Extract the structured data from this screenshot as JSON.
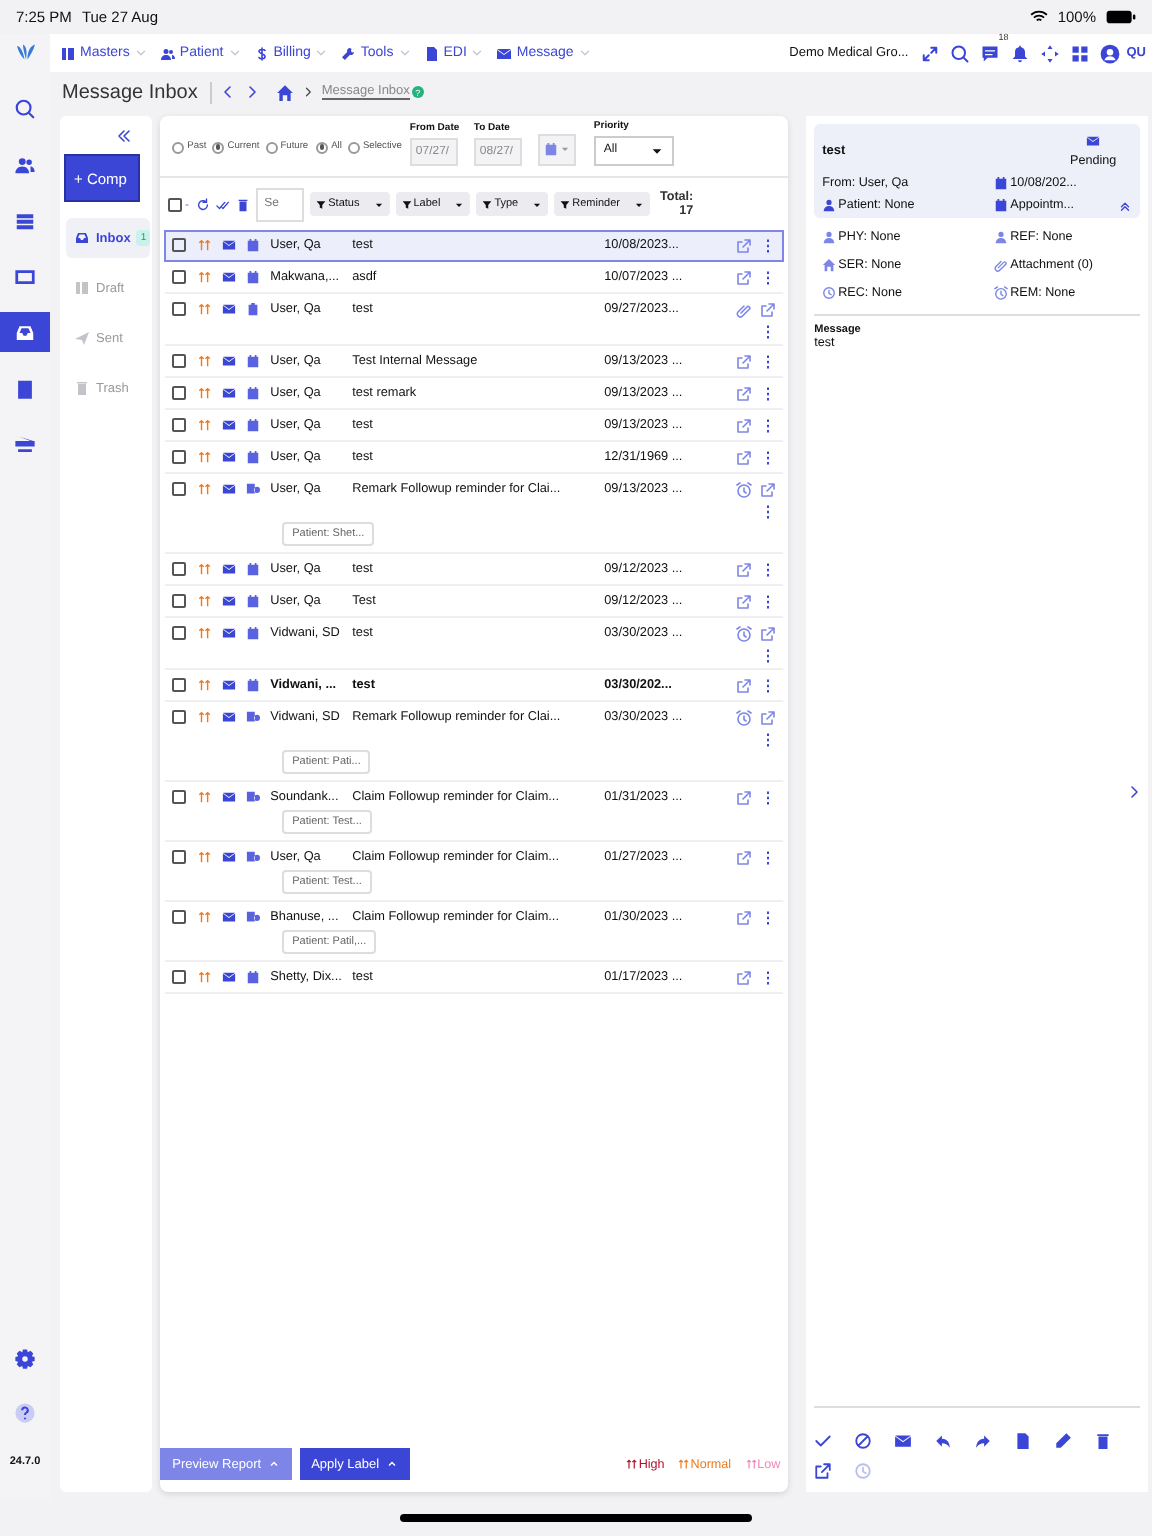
{
  "status_bar": {
    "time": "7:25 PM",
    "date": "Tue 27 Aug",
    "battery": "100%"
  },
  "nav": {
    "menus": [
      "Masters",
      "Patient",
      "Billing",
      "Tools",
      "EDI",
      "Message"
    ],
    "org": "Demo Medical Gro...",
    "notification_count": "18",
    "user_initials": "QU"
  },
  "rail": {
    "items": [
      {
        "selected": false
      },
      {
        "selected": false
      },
      {
        "selected": false
      },
      {
        "selected": false
      },
      {
        "selected": true
      },
      {
        "selected": false
      },
      {
        "selected": false
      }
    ],
    "version": "24.7.0"
  },
  "title": "Message Inbox",
  "breadcrumb": "Message Inbox",
  "help_badge": "?",
  "folders": {
    "compose": "+ Comp",
    "items": [
      {
        "label": "Inbox",
        "selected": true,
        "count": "1"
      },
      {
        "label": "Draft",
        "selected": false
      },
      {
        "label": "Sent",
        "selected": false
      },
      {
        "label": "Trash",
        "selected": false
      }
    ]
  },
  "filters": {
    "period": [
      {
        "label": "Past",
        "selected": false
      },
      {
        "label": "Current",
        "selected": true
      },
      {
        "label": "Future",
        "selected": false
      }
    ],
    "scope": [
      {
        "label": "All",
        "selected": true
      },
      {
        "label": "Selective",
        "selected": false
      }
    ],
    "from_date": {
      "label": "From Date",
      "value": "07/27/",
      "disabled": true
    },
    "to_date": {
      "label": "To Date",
      "value": "08/27/",
      "disabled": true
    },
    "priority": {
      "label": "Priority",
      "value": "All"
    }
  },
  "toolbar": {
    "select_all_checked": false,
    "search_placeholder": "Se",
    "dropdowns": [
      "Status",
      "Label",
      "Type",
      "Reminder"
    ],
    "total_label": "Total:",
    "total": "17"
  },
  "messages": [
    {
      "kind": "appointment",
      "checked": false,
      "selected": true,
      "unread": false,
      "has_attachment": false,
      "has_alarm": false,
      "sender": "User, Qa",
      "subject": "test",
      "date": "10/08/2023..."
    },
    {
      "kind": "appointment",
      "checked": false,
      "selected": false,
      "unread": false,
      "has_attachment": false,
      "has_alarm": false,
      "sender": "Makwana,...",
      "subject": "asdf",
      "date": "10/07/2023 ..."
    },
    {
      "kind": "task",
      "checked": false,
      "selected": false,
      "unread": false,
      "has_attachment": true,
      "has_alarm": false,
      "sender": "User, Qa",
      "subject": "test",
      "date": "09/27/2023..."
    },
    {
      "kind": "appointment",
      "checked": false,
      "selected": false,
      "unread": false,
      "has_attachment": false,
      "has_alarm": false,
      "sender": "User, Qa",
      "subject": "Test Internal Message",
      "date": "09/13/2023 ..."
    },
    {
      "kind": "appointment",
      "checked": false,
      "selected": false,
      "unread": false,
      "has_attachment": false,
      "has_alarm": false,
      "sender": "User, Qa",
      "subject": "test remark",
      "date": "09/13/2023 ..."
    },
    {
      "kind": "appointment",
      "checked": false,
      "selected": false,
      "unread": false,
      "has_attachment": false,
      "has_alarm": false,
      "sender": "User, Qa",
      "subject": "test",
      "date": "09/13/2023 ..."
    },
    {
      "kind": "appointment",
      "checked": false,
      "selected": false,
      "unread": false,
      "has_attachment": false,
      "has_alarm": false,
      "sender": "User, Qa",
      "subject": "test",
      "date": "12/31/1969 ..."
    },
    {
      "kind": "reminder",
      "checked": false,
      "selected": false,
      "unread": false,
      "has_attachment": false,
      "has_alarm": true,
      "sender": "User, Qa",
      "subject": "Remark Followup reminder for Clai...",
      "date": "09/13/2023 ...",
      "patient": "Patient: Shet..."
    },
    {
      "kind": "appointment",
      "checked": false,
      "selected": false,
      "unread": false,
      "has_attachment": false,
      "has_alarm": false,
      "sender": "User, Qa",
      "subject": "test",
      "date": "09/12/2023 ..."
    },
    {
      "kind": "appointment",
      "checked": false,
      "selected": false,
      "unread": false,
      "has_attachment": false,
      "has_alarm": false,
      "sender": "User, Qa",
      "subject": "Test",
      "date": "09/12/2023 ..."
    },
    {
      "kind": "appointment",
      "checked": false,
      "selected": false,
      "unread": false,
      "has_attachment": false,
      "has_alarm": true,
      "sender": "Vidwani, SD",
      "subject": "test",
      "date": "03/30/2023 ..."
    },
    {
      "kind": "appointment",
      "checked": false,
      "selected": false,
      "unread": true,
      "has_attachment": false,
      "has_alarm": false,
      "sender": "Vidwani, ...",
      "subject": "test",
      "date": "03/30/202..."
    },
    {
      "kind": "reminder",
      "checked": false,
      "selected": false,
      "unread": false,
      "has_attachment": false,
      "has_alarm": true,
      "sender": "Vidwani, SD",
      "subject": "Remark Followup reminder for Clai...",
      "date": "03/30/2023 ...",
      "patient": "Patient: Pati..."
    },
    {
      "kind": "reminder",
      "checked": false,
      "selected": false,
      "unread": false,
      "has_attachment": false,
      "has_alarm": false,
      "sender": "Soundank...",
      "subject": "Claim Followup reminder for Claim...",
      "date": "01/31/2023 ...",
      "patient": "Patient: Test..."
    },
    {
      "kind": "reminder",
      "checked": false,
      "selected": false,
      "unread": false,
      "has_attachment": false,
      "has_alarm": false,
      "sender": "User, Qa",
      "subject": "Claim Followup reminder for Claim...",
      "date": "01/27/2023 ...",
      "patient": "Patient: Test..."
    },
    {
      "kind": "reminder",
      "checked": false,
      "selected": false,
      "unread": false,
      "has_attachment": false,
      "has_alarm": false,
      "sender": "Bhanuse, ...",
      "subject": "Claim Followup reminder for Claim...",
      "date": "01/30/2023 ...",
      "patient": "Patient: Patil,..."
    },
    {
      "kind": "appointment",
      "checked": false,
      "selected": false,
      "unread": false,
      "has_attachment": false,
      "has_alarm": false,
      "sender": "Shetty, Dix...",
      "subject": "test",
      "date": "01/17/2023 ..."
    }
  ],
  "buttons": [
    {
      "label": "Preview Report",
      "kind": "secondary"
    },
    {
      "label": "Apply Label",
      "kind": "primary"
    }
  ],
  "legend": [
    {
      "label": "High",
      "color": "#b3122e"
    },
    {
      "label": "Normal",
      "color": "#f07a1a"
    },
    {
      "label": "Low",
      "color": "#f585bb"
    }
  ],
  "detail": {
    "subject": "test",
    "status": "Pending",
    "from": "From: User, Qa",
    "date": "10/08/202...",
    "patient": "Patient: None",
    "appointment": "Appointm...",
    "fields": [
      "PHY: None",
      "REF: None",
      "SER: None",
      "Attachment (0)",
      "REC: None",
      "REM: None"
    ],
    "message_label": "Message",
    "message": "test",
    "actions": [
      {
        "disabled": false
      },
      {
        "disabled": false
      },
      {
        "disabled": false
      },
      {
        "disabled": false
      },
      {
        "disabled": false
      },
      {
        "disabled": false
      },
      {
        "disabled": false
      },
      {
        "disabled": false
      },
      {
        "disabled": false
      },
      {
        "disabled": true
      }
    ]
  }
}
